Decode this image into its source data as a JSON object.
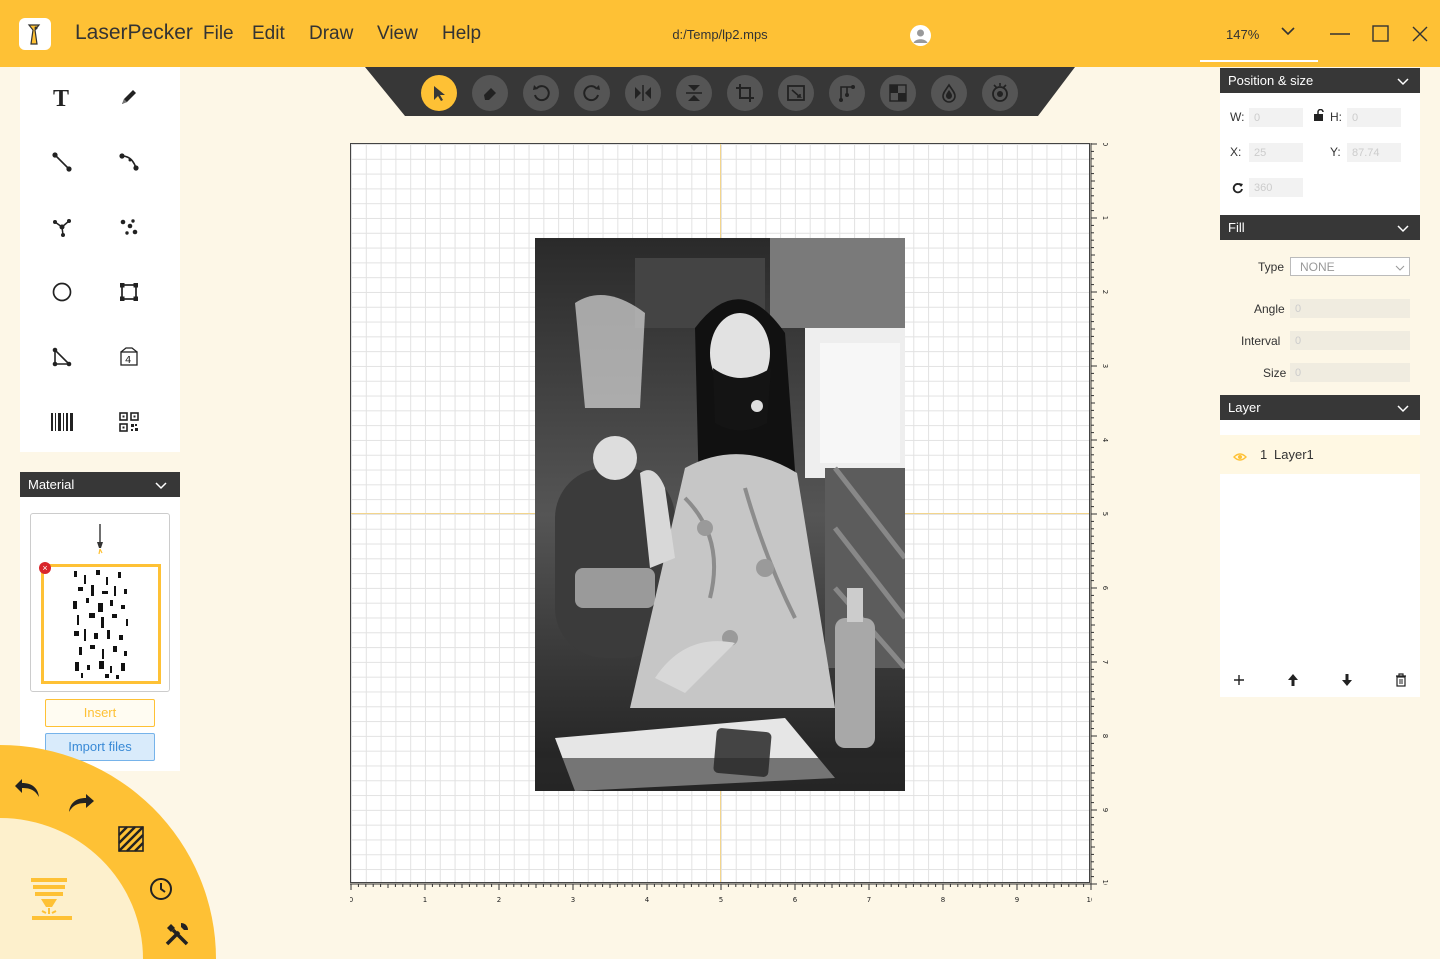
{
  "app": {
    "name": "LaserPecker",
    "file_path": "d:/Temp/lp2.mps"
  },
  "menu": [
    "File",
    "Edit",
    "Draw",
    "View",
    "Help"
  ],
  "zoom": {
    "value": "147%"
  },
  "window_controls": [
    "minimize-icon",
    "maximize-icon",
    "close-icon"
  ],
  "colors": {
    "accent": "#fec135",
    "dark": "#373737",
    "background": "#fdf7e7",
    "link": "#3a8ad6"
  },
  "tools": [
    "text-tool-icon",
    "pen-tool-icon",
    "line-tool-icon",
    "curve-tool-icon",
    "node-edit-icon",
    "point-edit-icon",
    "circle-tool-icon",
    "rectangle-tool-icon",
    "polygon-tool-icon",
    "number-tool-icon",
    "barcode-tool-icon",
    "qrcode-tool-icon"
  ],
  "toolbar": [
    "select-icon",
    "eraser-icon",
    "undo-rotate-icon",
    "redo-rotate-icon",
    "flip-horizontal-icon",
    "flip-vertical-icon",
    "crop-icon",
    "transform-icon",
    "path-icon",
    "pattern-icon",
    "contour-icon",
    "laser-icon"
  ],
  "material": {
    "header": "Material",
    "insert_label": "Insert",
    "import_label": "Import files"
  },
  "ruler": {
    "ticks": [
      "0",
      "1",
      "2",
      "3",
      "4",
      "5",
      "6",
      "7",
      "8",
      "9",
      "10"
    ]
  },
  "position_size": {
    "header": "Position & size",
    "w_label": "W:",
    "w_value": "0",
    "h_label": "H:",
    "h_value": "0",
    "x_label": "X:",
    "x_value": "25",
    "y_label": "Y:",
    "y_value": "87.74",
    "rotation_value": "360"
  },
  "fill": {
    "header": "Fill",
    "type_label": "Type",
    "type_value": "NONE",
    "angle_label": "Angle",
    "angle_value": "0",
    "interval_label": "Interval",
    "interval_value": "0",
    "size_label": "Size",
    "size_value": "0"
  },
  "layer": {
    "header": "Layer",
    "items": [
      {
        "index": "1",
        "name": "Layer1"
      }
    ]
  }
}
